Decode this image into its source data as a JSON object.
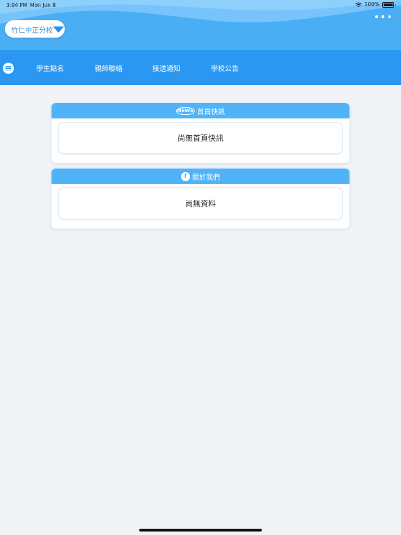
{
  "status_bar": {
    "time": "3:04 PM",
    "date": "Mon Jun 8",
    "battery_text": "100%",
    "battery_level": 1.0
  },
  "header": {
    "school_selector": "竹仁中正分校",
    "more_icon": "ellipsis-icon",
    "background_color": "#4aaef5",
    "wave_color": "#7ec8fb"
  },
  "nav": {
    "menu_icon": "hamburger-icon",
    "items": [
      {
        "label": "學生點名"
      },
      {
        "label": "親師聯絡"
      },
      {
        "label": "接送通知"
      },
      {
        "label": "學校公告"
      }
    ],
    "background_color": "#2a97f2"
  },
  "cards": [
    {
      "icon": "news-icon",
      "icon_text": "NEWS",
      "title": "首頁快訊",
      "body": "尚無首頁快訊"
    },
    {
      "icon": "info-icon",
      "icon_text": "i",
      "title": "關於我們",
      "body": "尚無資料"
    }
  ],
  "colors": {
    "card_header": "#50b3f7",
    "page_background": "#f1f3f6"
  }
}
